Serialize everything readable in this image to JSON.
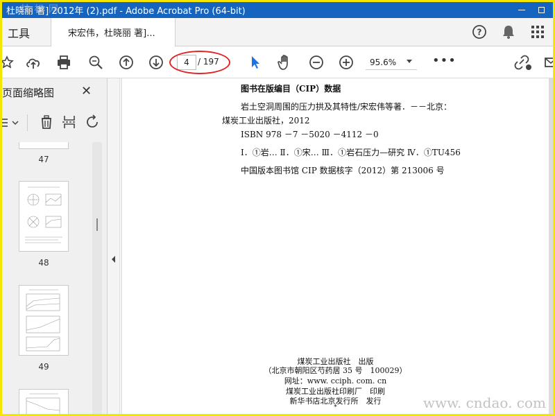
{
  "window": {
    "title": "杜晓丽 著] 2012年 (2).pdf - Adobe Acrobat Pro (64-bit)",
    "watermark_top": "甘 标 网"
  },
  "tabs": {
    "tools_label": "工具",
    "document_tab_label": "宋宏伟，杜晓丽 著]..."
  },
  "toolbar": {
    "current_page": "4",
    "total_pages": "/ 197",
    "zoom": "95.6%",
    "more": "•••"
  },
  "left_pane": {
    "title": "页面缩略图",
    "thumbnails": [
      {
        "label": "47"
      },
      {
        "label": "48"
      },
      {
        "label": "49"
      }
    ]
  },
  "document": {
    "cip_title": "图书在版编目（CIP）数据",
    "lines": [
      "岩土空洞周围的压力拱及其特性/宋宏伟等著．－－北京：",
      "煤炭工业出版社，2012",
      "ISBN 978 －7 －5020 －4112 －0",
      "Ⅰ．①岩… Ⅱ．①宋… Ⅲ．①岩石压力—研究 Ⅳ．①TU456",
      "中国版本图书馆 CIP 数据核字（2012）第 213006 号"
    ],
    "publisher_lines": [
      "煤炭工业出版社　出版",
      "（北京市朝阳区芍药居 35 号　100029）",
      "网址：www. cciph. com. cn",
      "煤炭工业出版社印刷厂　印刷",
      "新华书店北京发行所　发行",
      "*"
    ]
  },
  "watermark_bottom": "www. cndao. com"
}
